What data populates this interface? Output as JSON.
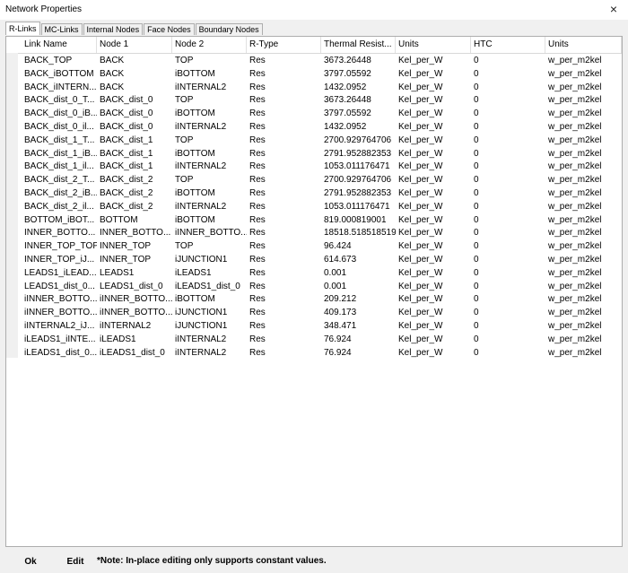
{
  "window": {
    "title": "Network Properties",
    "close_glyph": "×"
  },
  "tabs": [
    "R-Links",
    "MC-Links",
    "Internal Nodes",
    "Face Nodes",
    "Boundary Nodes"
  ],
  "columns": [
    "Link Name",
    "Node 1",
    "Node 2",
    "R-Type",
    "Thermal Resist...",
    "Units",
    "HTC",
    "Units"
  ],
  "rows": [
    [
      "BACK_TOP",
      "BACK",
      "TOP",
      "Res",
      "3673.26448",
      "Kel_per_W",
      "0",
      "w_per_m2kel"
    ],
    [
      "BACK_iBOTTOM",
      "BACK",
      "iBOTTOM",
      "Res",
      "3797.05592",
      "Kel_per_W",
      "0",
      "w_per_m2kel"
    ],
    [
      "BACK_iINTERN...",
      "BACK",
      "iINTERNAL2",
      "Res",
      "1432.0952",
      "Kel_per_W",
      "0",
      "w_per_m2kel"
    ],
    [
      "BACK_dist_0_T...",
      "BACK_dist_0",
      "TOP",
      "Res",
      "3673.26448",
      "Kel_per_W",
      "0",
      "w_per_m2kel"
    ],
    [
      "BACK_dist_0_iB...",
      "BACK_dist_0",
      "iBOTTOM",
      "Res",
      "3797.05592",
      "Kel_per_W",
      "0",
      "w_per_m2kel"
    ],
    [
      "BACK_dist_0_il...",
      "BACK_dist_0",
      "iINTERNAL2",
      "Res",
      "1432.0952",
      "Kel_per_W",
      "0",
      "w_per_m2kel"
    ],
    [
      "BACK_dist_1_T...",
      "BACK_dist_1",
      "TOP",
      "Res",
      "2700.929764706",
      "Kel_per_W",
      "0",
      "w_per_m2kel"
    ],
    [
      "BACK_dist_1_iB...",
      "BACK_dist_1",
      "iBOTTOM",
      "Res",
      "2791.952882353",
      "Kel_per_W",
      "0",
      "w_per_m2kel"
    ],
    [
      "BACK_dist_1_il...",
      "BACK_dist_1",
      "iINTERNAL2",
      "Res",
      "1053.011176471",
      "Kel_per_W",
      "0",
      "w_per_m2kel"
    ],
    [
      "BACK_dist_2_T...",
      "BACK_dist_2",
      "TOP",
      "Res",
      "2700.929764706",
      "Kel_per_W",
      "0",
      "w_per_m2kel"
    ],
    [
      "BACK_dist_2_iB...",
      "BACK_dist_2",
      "iBOTTOM",
      "Res",
      "2791.952882353",
      "Kel_per_W",
      "0",
      "w_per_m2kel"
    ],
    [
      "BACK_dist_2_il...",
      "BACK_dist_2",
      "iINTERNAL2",
      "Res",
      "1053.011176471",
      "Kel_per_W",
      "0",
      "w_per_m2kel"
    ],
    [
      "BOTTOM_iBOT...",
      "BOTTOM",
      "iBOTTOM",
      "Res",
      "819.000819001",
      "Kel_per_W",
      "0",
      "w_per_m2kel"
    ],
    [
      "INNER_BOTTO...",
      "INNER_BOTTO...",
      "iINNER_BOTTO...",
      "Res",
      "18518.518518519",
      "Kel_per_W",
      "0",
      "w_per_m2kel"
    ],
    [
      "INNER_TOP_TOP",
      "INNER_TOP",
      "TOP",
      "Res",
      "96.424",
      "Kel_per_W",
      "0",
      "w_per_m2kel"
    ],
    [
      "INNER_TOP_iJ...",
      "INNER_TOP",
      "iJUNCTION1",
      "Res",
      "614.673",
      "Kel_per_W",
      "0",
      "w_per_m2kel"
    ],
    [
      "LEADS1_iLEAD...",
      "LEADS1",
      "iLEADS1",
      "Res",
      "0.001",
      "Kel_per_W",
      "0",
      "w_per_m2kel"
    ],
    [
      "LEADS1_dist_0...",
      "LEADS1_dist_0",
      "iLEADS1_dist_0",
      "Res",
      "0.001",
      "Kel_per_W",
      "0",
      "w_per_m2kel"
    ],
    [
      "iINNER_BOTTO...",
      "iINNER_BOTTO...",
      "iBOTTOM",
      "Res",
      "209.212",
      "Kel_per_W",
      "0",
      "w_per_m2kel"
    ],
    [
      "iINNER_BOTTO...",
      "iINNER_BOTTO...",
      "iJUNCTION1",
      "Res",
      "409.173",
      "Kel_per_W",
      "0",
      "w_per_m2kel"
    ],
    [
      "iINTERNAL2_iJ...",
      "iINTERNAL2",
      "iJUNCTION1",
      "Res",
      "348.471",
      "Kel_per_W",
      "0",
      "w_per_m2kel"
    ],
    [
      "iLEADS1_iINTE...",
      "iLEADS1",
      "iINTERNAL2",
      "Res",
      "76.924",
      "Kel_per_W",
      "0",
      "w_per_m2kel"
    ],
    [
      "iLEADS1_dist_0...",
      "iLEADS1_dist_0",
      "iINTERNAL2",
      "Res",
      "76.924",
      "Kel_per_W",
      "0",
      "w_per_m2kel"
    ]
  ],
  "footer": {
    "ok_label": "Ok",
    "edit_label": "Edit",
    "note": "*Note: In-place editing only supports constant values."
  }
}
